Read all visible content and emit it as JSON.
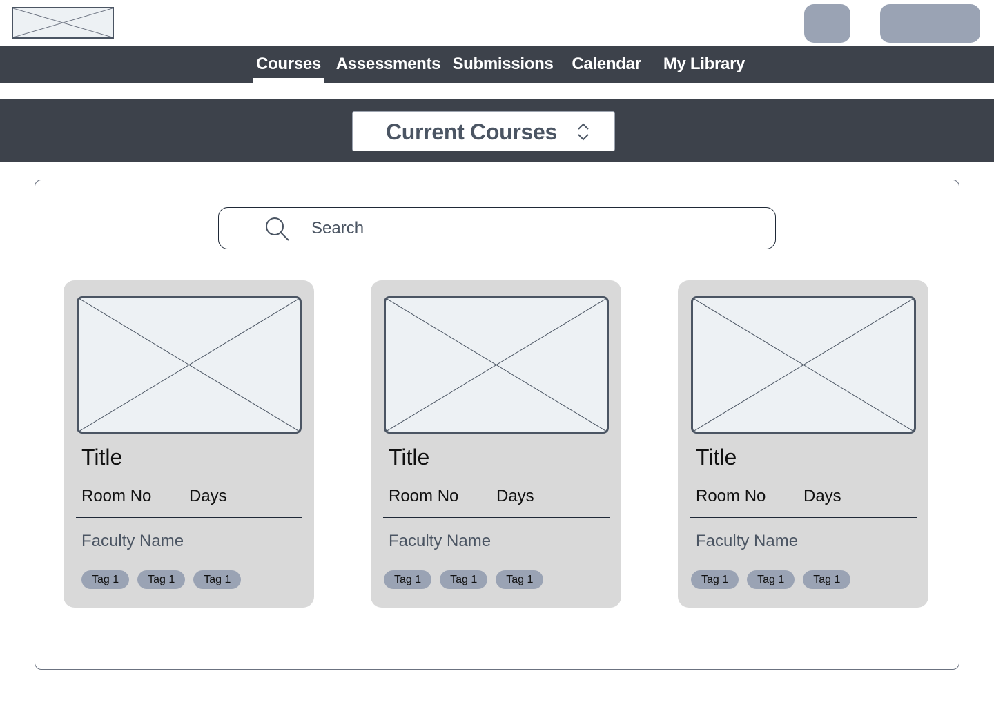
{
  "colors": {
    "nav_background": "#3d424b",
    "button_placeholder": "#9aa3b4",
    "card_background": "#d9d9d9",
    "image_placeholder": "#edf1f4",
    "tag_background": "#9aa3b4"
  },
  "nav": {
    "items": [
      {
        "label": "Courses",
        "active": true
      },
      {
        "label": "Assessments"
      },
      {
        "label": "Submissions"
      },
      {
        "label": "Calendar"
      },
      {
        "label": "My Library"
      }
    ]
  },
  "banner": {
    "selector_label": "Current Courses",
    "selector_icon": "chevron-up-down-icon"
  },
  "search": {
    "placeholder": "Search",
    "icon": "search-icon"
  },
  "cards": [
    {
      "title": "Title",
      "room": "Room No",
      "days": "Days",
      "faculty": "Faculty Name",
      "tags": [
        "Tag 1",
        "Tag 1",
        "Tag 1"
      ]
    },
    {
      "title": "Title",
      "room": "Room No",
      "days": "Days",
      "faculty": "Faculty Name",
      "tags": [
        "Tag 1",
        "Tag 1",
        "Tag 1"
      ]
    },
    {
      "title": "Title",
      "room": "Room No",
      "days": "Days",
      "faculty": "Faculty Name",
      "tags": [
        "Tag 1",
        "Tag 1",
        "Tag 1"
      ]
    }
  ]
}
